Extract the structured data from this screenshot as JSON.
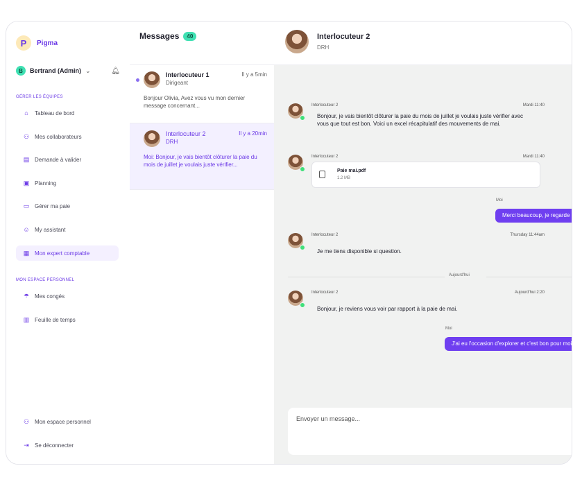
{
  "app": {
    "name": "Pigma",
    "logo_letter": "P"
  },
  "user": {
    "initial": "B",
    "name": "Bertrand (Admin)"
  },
  "sidebar": {
    "section1_title": "GÉRER LES ÉQUIPES",
    "section2_title": "MON ESPACE PERSONNEL",
    "items": [
      {
        "label": "Tableau de bord",
        "icon": "home-icon"
      },
      {
        "label": "Mes collaborateurs",
        "icon": "users-icon"
      },
      {
        "label": "Demande à valider",
        "icon": "document-icon"
      },
      {
        "label": "Planning",
        "icon": "calendar-icon"
      },
      {
        "label": "Gérer ma paie",
        "icon": "wallet-icon"
      },
      {
        "label": "My assistant",
        "icon": "chat-bot-icon"
      },
      {
        "label": "Mon expert comptable",
        "icon": "briefcase-icon"
      },
      {
        "label": "Mes congés",
        "icon": "beach-icon"
      },
      {
        "label": "Feuille de temps",
        "icon": "timesheet-icon"
      }
    ],
    "bottom": [
      {
        "label": "Mon espace personnel",
        "icon": "users-icon"
      },
      {
        "label": "Se déconnecter",
        "icon": "logout-icon"
      }
    ],
    "active_color": "#6a38e6"
  },
  "messages": {
    "title": "Messages",
    "count": "40",
    "conversations": [
      {
        "name": "Interlocuteur 1",
        "role": "Dirigeant",
        "time": "Il y a 5min",
        "preview": "Bonjour Olivia, Avez vous vu mon dernier message concernant..."
      },
      {
        "name": "Interlocuteur 2",
        "role": "DRH",
        "time": "Il y a 20min",
        "preview": "Moi: Bonjour, je vais bientôt clôturer la paie du mois de juillet je voulais juste vérifier..."
      }
    ]
  },
  "chat": {
    "name": "Interlocuteur 2",
    "role": "DRH",
    "messages": [
      {
        "sender": "Interlocuteur 2",
        "time": "Mardi 11:40",
        "text": "Bonjour, je vais bientôt clôturer la paie du mois de juillet je voulais juste vérifier avec vous que tout est bon. Voici un excel récapitulatif des mouvements de mai."
      },
      {
        "sender": "Interlocuteur 2",
        "time": "Mardi 11:40",
        "file_name": "Paie mai.pdf",
        "file_size": "1.2 MB"
      },
      {
        "sender": "Moi",
        "text": "Merci beaucoup, je regarde"
      },
      {
        "sender": "Interlocuteur 2",
        "time": "Thursday 11:44am",
        "text": "Je me tiens disponible si question."
      },
      {
        "sender": "Interlocuteur 2",
        "time": "Aujourd'hui 2:20",
        "text": "Bonjour, je reviens vous voir par rapport à la paie de mai."
      },
      {
        "sender": "Moi",
        "text": "J'ai eu l'occasion d'explorer et c'est bon pour moi"
      }
    ],
    "day_divider": "Aujourd'hui",
    "composer_placeholder": "Envoyer un message..."
  },
  "colors": {
    "accent": "#6f3ff0",
    "badge": "#3fe0b2",
    "online": "#3fe07a"
  }
}
